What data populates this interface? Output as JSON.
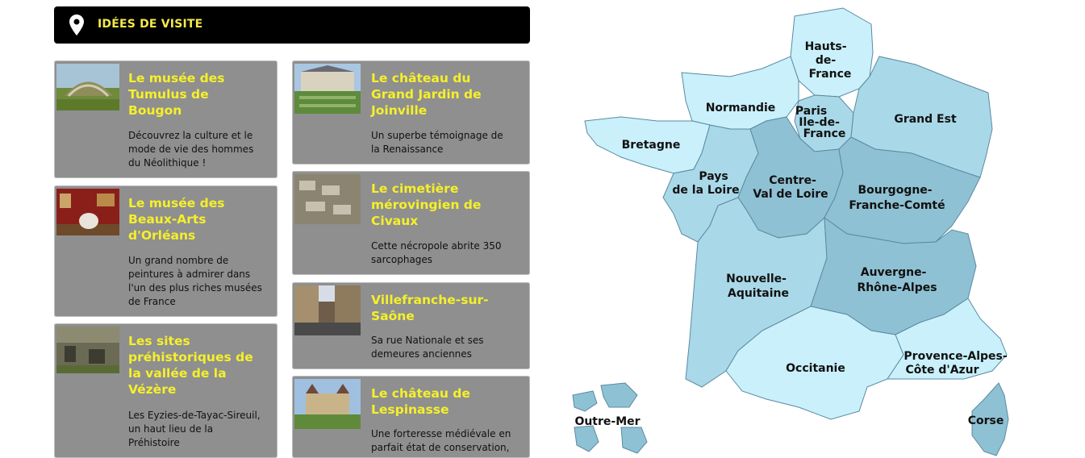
{
  "header": {
    "title": "IDÉES DE VISITE",
    "icon": "location-pin-icon"
  },
  "cards": [
    {
      "title": "Le musée des Tumulus de Bougon",
      "lines": [
        "Le musée des",
        "Tumulus de",
        "Bougon"
      ],
      "desc_lines": [
        "Découvrez la culture et le",
        "mode de vie des hommes",
        "du Néolithique !"
      ]
    },
    {
      "title": "Le musée des Beaux-Arts d'Orléans",
      "lines": [
        "Le musée des",
        "Beaux-Arts",
        "d'Orléans"
      ],
      "desc_lines": [
        "Un grand nombre de",
        "peintures à admirer dans",
        "l'un des plus riches musées",
        "de France"
      ]
    },
    {
      "title": "Les sites préhistoriques de la vallée de la Vézère",
      "lines": [
        "Les sites",
        "préhistoriques de",
        "la vallée de la",
        "Vézère"
      ],
      "desc_lines": [
        "Les Eyzies-de-Tayac-Sireuil,",
        "un haut lieu de la",
        "Préhistoire"
      ]
    },
    {
      "title": "Le château du Grand Jardin de Joinville",
      "lines": [
        "Le château du",
        "Grand Jardin de",
        "Joinville"
      ],
      "desc_lines": [
        "Un superbe témoignage de",
        "la Renaissance"
      ]
    },
    {
      "title": "Le cimetière mérovingien de Civaux",
      "lines": [
        "Le cimetière",
        "mérovingien de",
        "Civaux"
      ],
      "desc_lines": [
        "Cette nécropole abrite 350",
        "sarcophages"
      ]
    },
    {
      "title": "Villefranche-sur-Saône",
      "lines": [
        "Villefranche-sur-",
        "Saône"
      ],
      "desc_lines": [
        "Sa rue Nationale et ses",
        "demeures anciennes"
      ]
    },
    {
      "title": "Le château de Lespinasse",
      "lines": [
        "Le château de",
        "Lespinasse"
      ],
      "desc_lines": [
        "Une forteresse médiévale en",
        "parfait état de conservation,"
      ]
    }
  ],
  "map": {
    "colors": {
      "light": "#c9f0fb",
      "mid": "#a9d8e8",
      "dark": "#8fc1d4"
    },
    "regions": [
      {
        "id": "hauts-de-france",
        "lines": [
          "Hauts-",
          "de-",
          "France"
        ]
      },
      {
        "id": "normandie",
        "lines": [
          "Normandie"
        ]
      },
      {
        "id": "ile-de-france",
        "lines": [
          "Paris",
          "Ile-de-",
          "France"
        ]
      },
      {
        "id": "grand-est",
        "lines": [
          "Grand Est"
        ]
      },
      {
        "id": "bretagne",
        "lines": [
          "Bretagne"
        ]
      },
      {
        "id": "pays-de-la-loire",
        "lines": [
          "Pays",
          "de la Loire"
        ]
      },
      {
        "id": "centre-val-de-loire",
        "lines": [
          "Centre-",
          "Val de Loire"
        ]
      },
      {
        "id": "bourgogne-franche-comte",
        "lines": [
          "Bourgogne-",
          "Franche-Comté"
        ]
      },
      {
        "id": "nouvelle-aquitaine",
        "lines": [
          "Nouvelle-",
          "Aquitaine"
        ]
      },
      {
        "id": "auvergne-rhone-alpes",
        "lines": [
          "Auvergne-",
          "Rhône-Alpes"
        ]
      },
      {
        "id": "occitanie",
        "lines": [
          "Occitanie"
        ]
      },
      {
        "id": "provence-alpes-cote-d-azur",
        "lines": [
          "Provence-Alpes-",
          "Côte d'Azur"
        ]
      },
      {
        "id": "corse",
        "lines": [
          "Corse"
        ]
      },
      {
        "id": "outre-mer",
        "lines": [
          "Outre-Mer"
        ]
      }
    ]
  }
}
